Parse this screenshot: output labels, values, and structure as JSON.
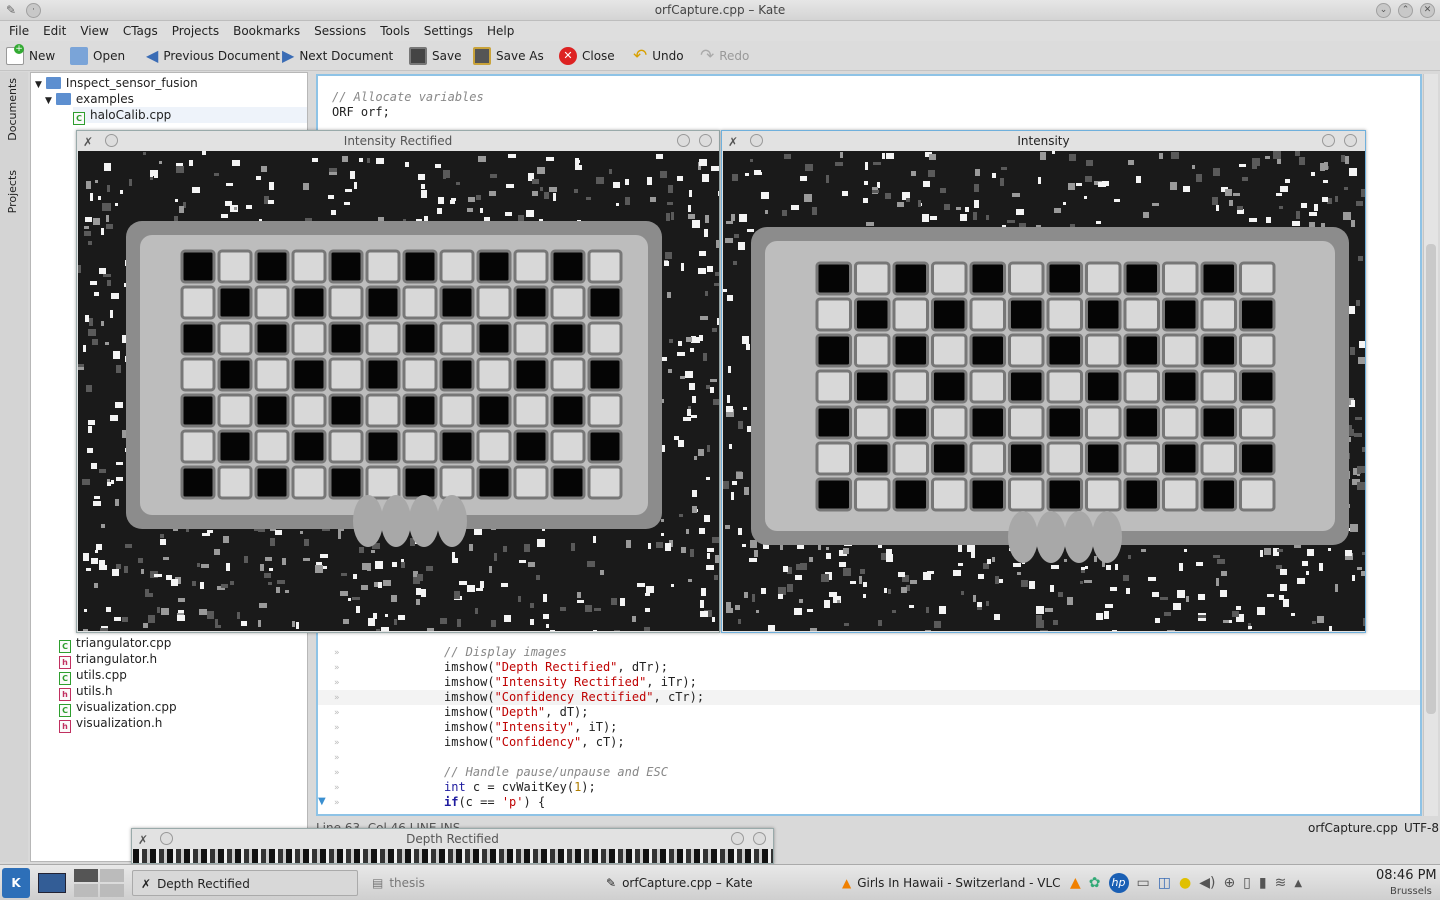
{
  "window": {
    "title": "orfCapture.cpp – Kate"
  },
  "menu": [
    "File",
    "Edit",
    "View",
    "CTags",
    "Projects",
    "Bookmarks",
    "Sessions",
    "Tools",
    "Settings",
    "Help"
  ],
  "toolbar": {
    "new": "New",
    "open": "Open",
    "prev": "Previous Document",
    "next": "Next Document",
    "save": "Save",
    "save_as": "Save As",
    "close": "Close",
    "undo": "Undo",
    "redo": "Redo"
  },
  "sidetabs": {
    "documents": "Documents",
    "projects": "Projects"
  },
  "tree": {
    "root": "Inspect_sensor_fusion",
    "folder": "examples",
    "top_files": [
      "haloCalib.cpp"
    ],
    "bottom_files": [
      {
        "name": "triangulator.cpp",
        "type": "cpp"
      },
      {
        "name": "triangulator.h",
        "type": "h"
      },
      {
        "name": "utils.cpp",
        "type": "cpp"
      },
      {
        "name": "utils.h",
        "type": "h"
      },
      {
        "name": "visualization.cpp",
        "type": "cpp"
      },
      {
        "name": "visualization.h",
        "type": "h"
      }
    ]
  },
  "code_top": {
    "comment": "// Allocate variables",
    "line": "ORF orf;"
  },
  "code": {
    "c1": "// Display images",
    "l1a": "imshow(",
    "l1s": "\"Depth Rectified\"",
    "l1b": ", dTr);",
    "l2a": "imshow(",
    "l2s": "\"Intensity Rectified\"",
    "l2b": ", iTr);",
    "l3a": "imshow(",
    "l3s": "\"Confidency Rectified\"",
    "l3b": ", cTr);",
    "l4a": "imshow(",
    "l4s": "\"Depth\"",
    "l4b": ", dT);",
    "l5a": "imshow(",
    "l5s": "\"Intensity\"",
    "l5b": ", iT);",
    "l6a": "imshow(",
    "l6s": "\"Confidency\"",
    "l6b": ", cT);",
    "c2": "// Handle pause/unpause and ESC",
    "l7kw": "int",
    "l7a": " c = cvWaitKey(",
    "l7n": "1",
    "l7b": ");",
    "l8kw": "if",
    "l8a": "(c == ",
    "l8s": "'p'",
    "l8b": ") {"
  },
  "status": {
    "left": "Line 63, Col 46   LINE  INS",
    "file": "orfCapture.cpp",
    "encoding": "UTF-8"
  },
  "cv_windows": {
    "intensity_rect": "Intensity Rectified",
    "intensity": "Intensity",
    "depth_rect": "Depth Rectified"
  },
  "taskbar": {
    "tasks": [
      "Depth Rectified",
      "thesis",
      "orfCapture.cpp – Kate",
      "Girls In Hawaii - Switzerland - VLC m"
    ],
    "time": "08:46 PM",
    "city": "Brussels"
  },
  "colors": {
    "accent": "#6fb0dc",
    "string": "#bf0303",
    "keyword": "#1f1c9f"
  }
}
